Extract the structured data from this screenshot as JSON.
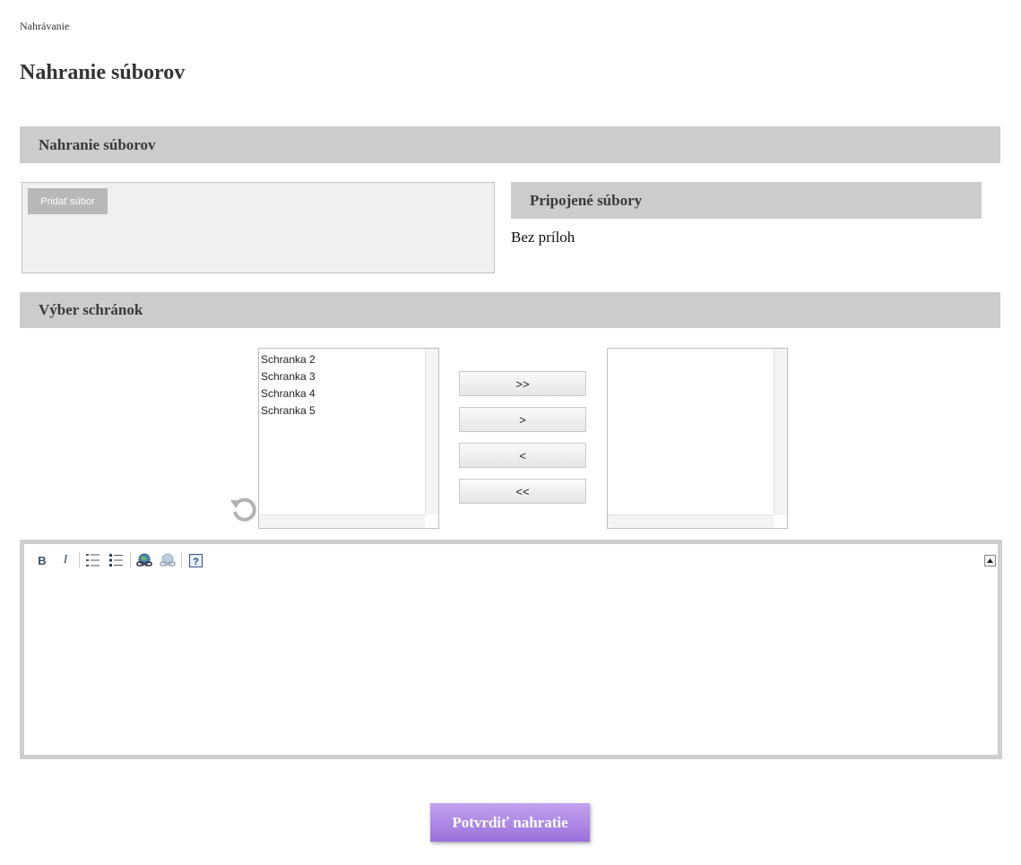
{
  "breadcrumb": "Nahrávanie",
  "page_title": "Nahranie súborov",
  "upload_section": {
    "header": "Nahranie súborov",
    "add_file_button": "Pridať súbor"
  },
  "attached_section": {
    "header": "Pripojené súbory",
    "empty_text": "Bez príloh"
  },
  "mailbox_section": {
    "header": "Výber schránok",
    "available_items": [
      "Schranka 2",
      "Schranka 3",
      "Schranka 4",
      "Schranka 5"
    ],
    "selected_items": [],
    "buttons": {
      "move_all_right": ">>",
      "move_right": ">",
      "move_left": "<",
      "move_all_left": "<<"
    },
    "reset_icon": "refresh-icon"
  },
  "editor": {
    "toolbar": {
      "bold": "B",
      "italic": "I",
      "icons": [
        "bold-icon",
        "italic-icon",
        "ordered-list-icon",
        "unordered-list-icon",
        "link-icon",
        "unlink-icon",
        "help-icon"
      ]
    },
    "content": ""
  },
  "confirm_button": "Potvrdiť nahratie",
  "colors": {
    "section_header_bg": "#cccccc",
    "confirm_button_bg": "#a87de2",
    "upload_area_bg": "#f0f0f0"
  }
}
